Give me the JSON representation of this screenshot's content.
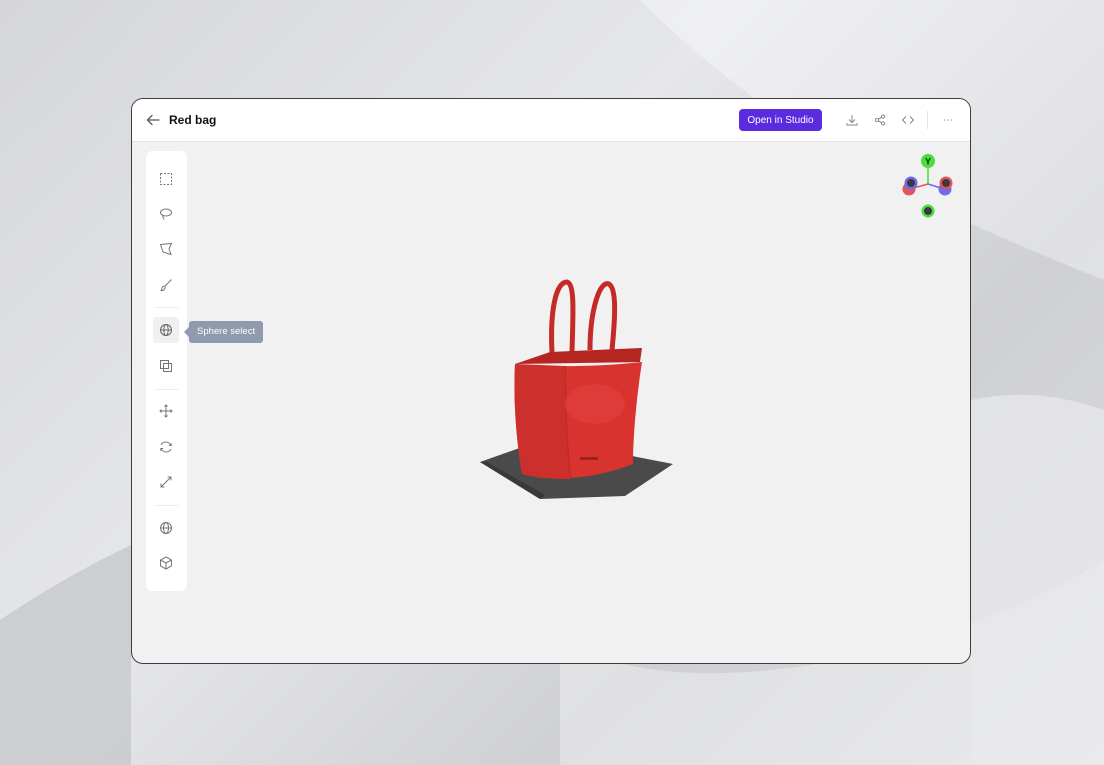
{
  "header": {
    "title": "Red bag",
    "open_studio_label": "Open in Studio"
  },
  "toolbar": {
    "tools": [
      {
        "name": "box-select-icon"
      },
      {
        "name": "lasso-select-icon"
      },
      {
        "name": "polygon-select-icon"
      },
      {
        "name": "brush-select-icon"
      },
      {
        "name": "sphere-select-icon",
        "active": true
      },
      {
        "name": "box-3d-select-icon"
      },
      {
        "name": "move-icon"
      },
      {
        "name": "rotate-icon"
      },
      {
        "name": "scale-icon"
      },
      {
        "name": "globe-icon"
      },
      {
        "name": "cube-icon"
      }
    ],
    "tooltip": "Sphere select"
  },
  "gizmo": {
    "axis_label": "Y",
    "colors": {
      "y": "#4ade3c",
      "x": "#e05555",
      "z": "#6b6bf0"
    }
  },
  "colors": {
    "accent": "#5b2be0",
    "bag": "#d8332f",
    "tooltip_bg": "#8f9aae"
  }
}
